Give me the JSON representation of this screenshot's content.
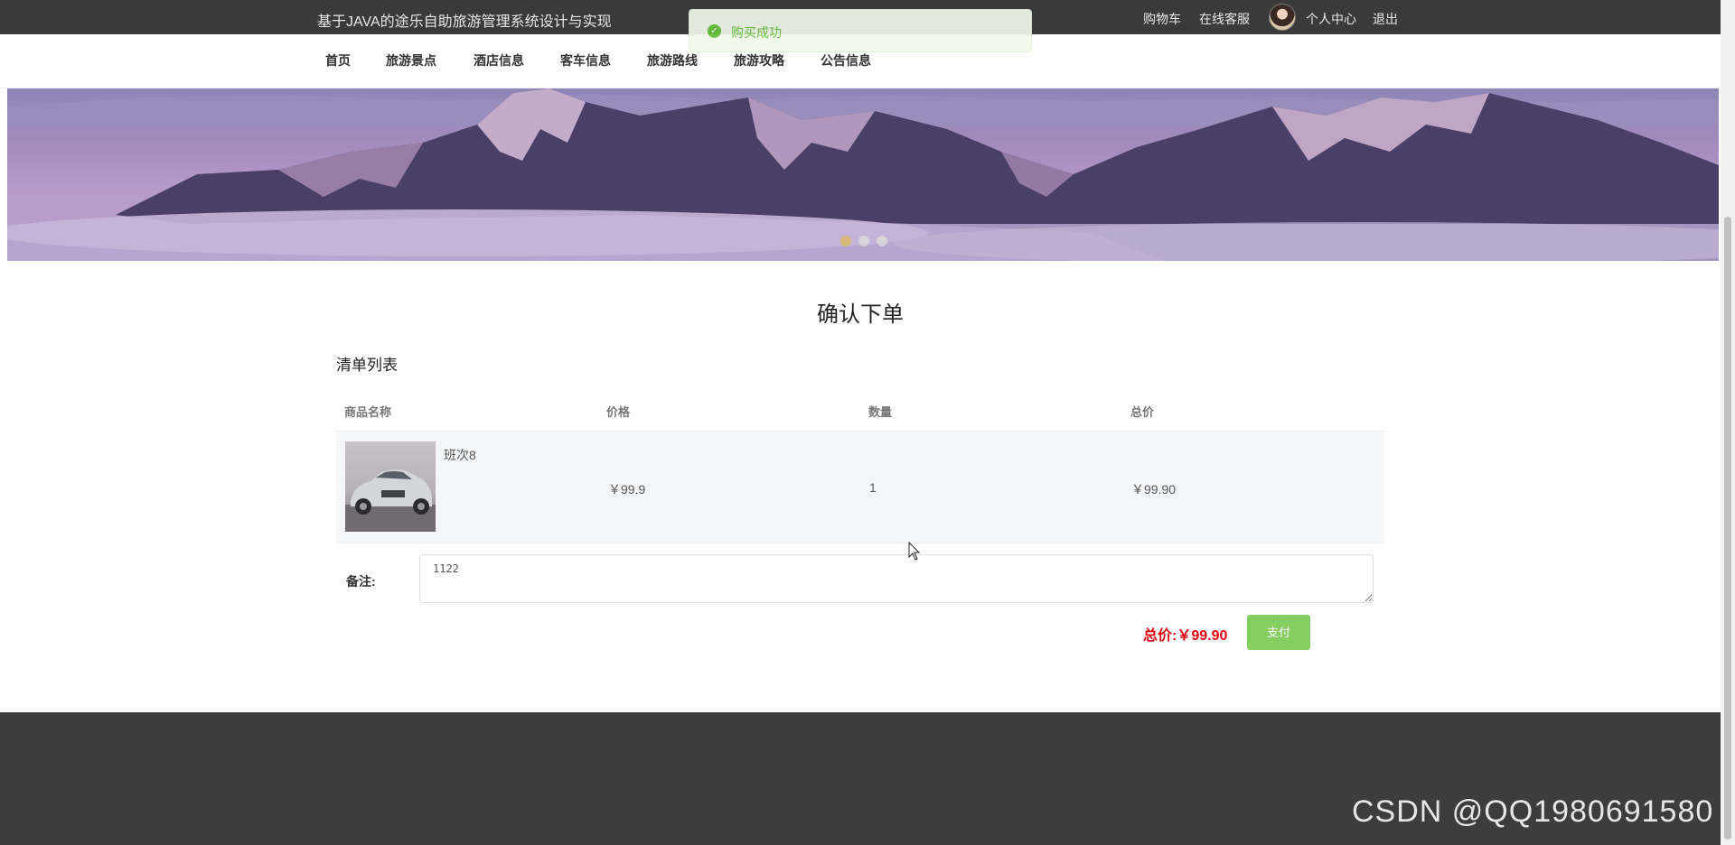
{
  "header": {
    "site_title": "基于JAVA的途乐自助旅游管理系统设计与实现",
    "links": {
      "cart": "购物车",
      "service": "在线客服",
      "profile": "个人中心",
      "logout": "退出"
    }
  },
  "toast": {
    "message": "购买成功",
    "icon": "check-circle-icon",
    "color": "#67c23a"
  },
  "nav": {
    "items": [
      {
        "label": "首页"
      },
      {
        "label": "旅游景点"
      },
      {
        "label": "酒店信息"
      },
      {
        "label": "客车信息"
      },
      {
        "label": "旅游路线"
      },
      {
        "label": "旅游攻略"
      },
      {
        "label": "公告信息"
      }
    ]
  },
  "banner": {
    "slides_count": 3,
    "active_index": 0
  },
  "main": {
    "page_title": "确认下单",
    "section_title": "清单列表",
    "columns": {
      "name": "商品名称",
      "price": "价格",
      "quantity": "数量",
      "total": "总价"
    },
    "items": [
      {
        "name": "班次8",
        "price": "￥99.9",
        "quantity": "1",
        "total": "￥99.90"
      }
    ],
    "note_label": "备注:",
    "note_value": "1122",
    "total_label": "总价:",
    "total_value": "￥99.90",
    "pay_label": "支付"
  },
  "colors": {
    "accent_red": "#e60012",
    "pay_green": "#85ce61",
    "topbar": "#3a3a3a",
    "footer": "#3d3d3d"
  },
  "watermark": "CSDN @QQ1980691580"
}
